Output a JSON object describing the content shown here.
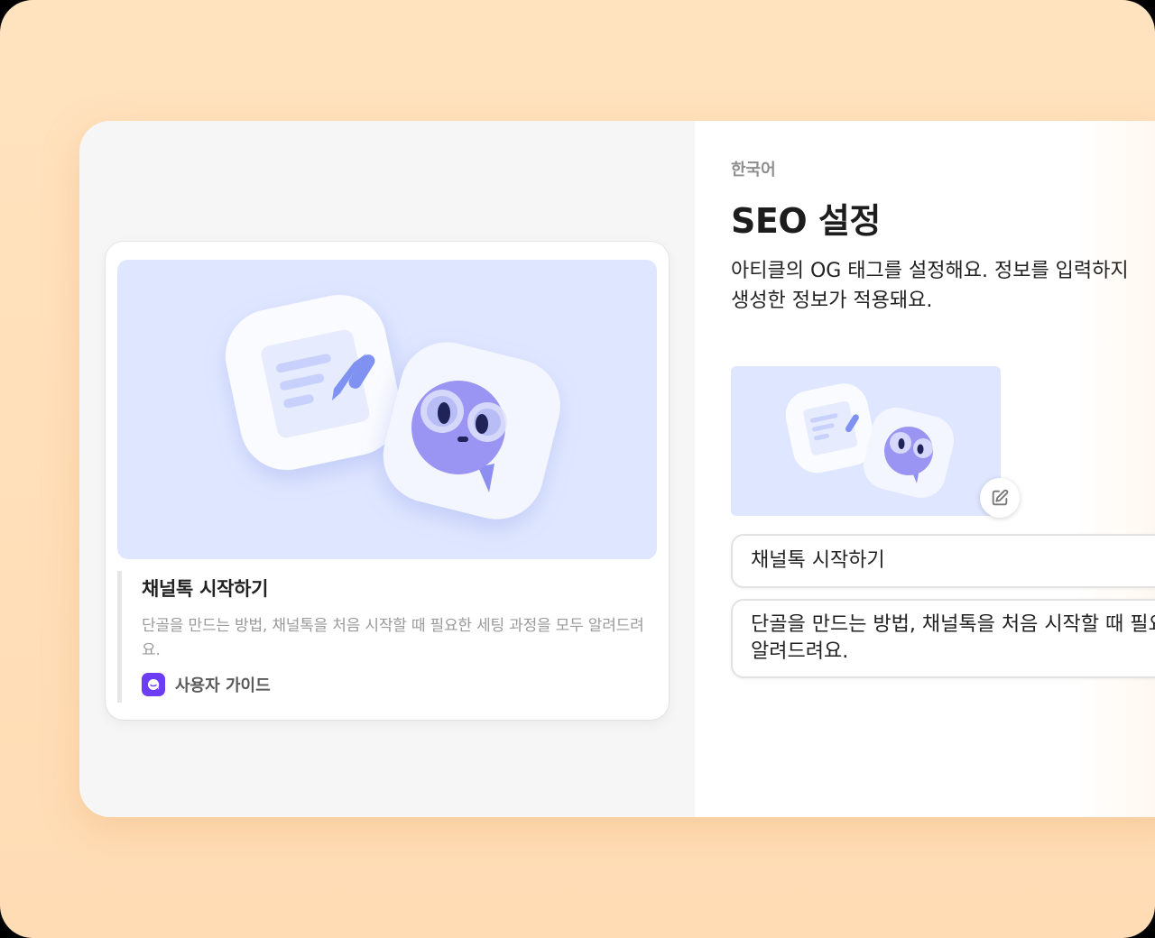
{
  "preview": {
    "title": "채널톡 시작하기",
    "description": "단골을 만드는 방법, 채널톡을 처음 시작할 때 필요한 세팅 과정을 모두 알려드려요.",
    "source_label": "사용자 가이드",
    "source_icon": "channeltalk-logo-icon"
  },
  "settings": {
    "language": "한국어",
    "title": "SEO 설정",
    "description_line1": "아티클의 OG 태그를 설정해요. 정보를 입력하지",
    "description_line2": "생성한 정보가 적용돼요.",
    "og_title_value": "채널톡 시작하기",
    "og_description_line1": "단골을 만드는 방법, 채널톡을 처음 시작할 때 필요한",
    "og_description_line2": "알려드려요.",
    "edit_icon": "edit-icon"
  },
  "colors": {
    "background": "#ffdfb8",
    "accent": "#6d3df5",
    "illustration_bg": "#dfe6ff"
  }
}
